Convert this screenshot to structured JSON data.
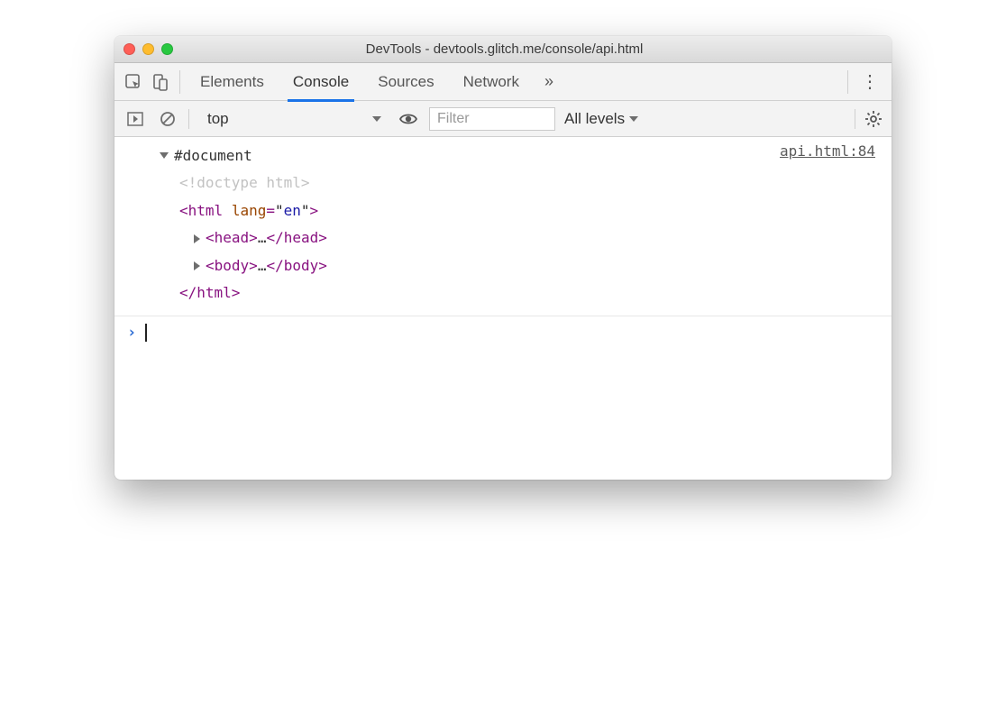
{
  "window": {
    "title": "DevTools - devtools.glitch.me/console/api.html"
  },
  "tabs": {
    "items": [
      "Elements",
      "Console",
      "Sources",
      "Network"
    ],
    "active_index": 1
  },
  "subbar": {
    "context": "top",
    "filter_placeholder": "Filter",
    "levels_label": "All levels"
  },
  "message": {
    "source_link": "api.html:84",
    "root_label": "#document",
    "doctype": "<!doctype html>",
    "html_open_tag": "html",
    "html_attr_name": "lang",
    "html_attr_value": "en",
    "head_tag": "head",
    "body_tag": "body",
    "ellipsis": "…",
    "html_close": "</html>"
  }
}
